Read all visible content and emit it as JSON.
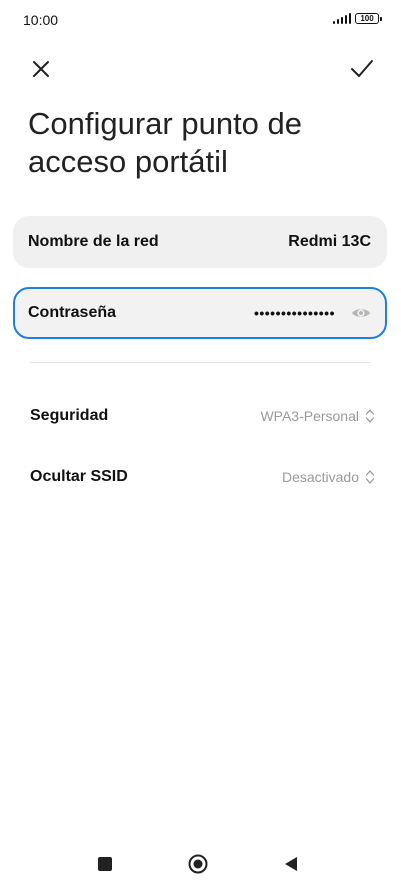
{
  "status_bar": {
    "time": "10:00",
    "battery": "100"
  },
  "top_bar": {
    "close_icon": "close-icon",
    "confirm_icon": "check-icon"
  },
  "title": "Configurar punto de acceso portátil",
  "fields": {
    "network_name": {
      "label": "Nombre de la red",
      "value": "Redmi 13C"
    },
    "password": {
      "label": "Contraseña",
      "value": "•••••••••••••••",
      "icon": "eye-icon"
    }
  },
  "settings": {
    "security": {
      "label": "Seguridad",
      "value": "WPA3-Personal"
    },
    "hide_ssid": {
      "label": "Ocultar SSID",
      "value": "Desactivado"
    }
  },
  "colors": {
    "accent": "#1f7ee0",
    "card_bg": "#f0f0f0",
    "muted_text": "#9a9a9a"
  },
  "nav_bar": {
    "recents_icon": "square-icon",
    "home_icon": "circle-icon",
    "back_icon": "triangle-back-icon"
  }
}
